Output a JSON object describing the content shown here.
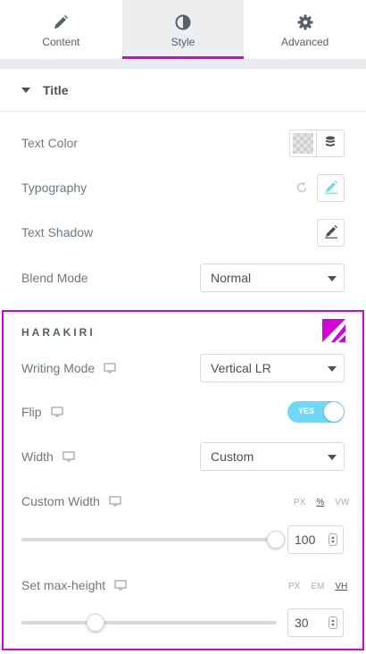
{
  "tabs": [
    {
      "label": "Content",
      "icon": "pencil-icon"
    },
    {
      "label": "Style",
      "icon": "half-circle-icon"
    },
    {
      "label": "Advanced",
      "icon": "gear-icon"
    }
  ],
  "active_tab": "Style",
  "section": {
    "title": "Title"
  },
  "controls": {
    "text_color": {
      "label": "Text Color"
    },
    "typography": {
      "label": "Typography"
    },
    "text_shadow": {
      "label": "Text Shadow"
    },
    "blend_mode": {
      "label": "Blend Mode",
      "value": "Normal"
    }
  },
  "harakiri": {
    "title": "HARAKIRI",
    "writing_mode": {
      "label": "Writing Mode",
      "value": "Vertical LR"
    },
    "flip": {
      "label": "Flip",
      "toggle_text": "YES",
      "on": true
    },
    "width": {
      "label": "Width",
      "value": "Custom"
    },
    "custom_width": {
      "label": "Custom Width",
      "units": [
        "PX",
        "%",
        "VW"
      ],
      "selected_unit": "%",
      "value": "100",
      "slider_fraction": 1.0
    },
    "max_height": {
      "label": "Set max-height",
      "units": [
        "PX",
        "EM",
        "VH"
      ],
      "selected_unit": "VH",
      "value": "30",
      "slider_fraction": 0.29
    }
  },
  "colors": {
    "accent": "#d004d4",
    "toggle_on": "#71d7f7",
    "pencil_active": "#71d7f7"
  }
}
